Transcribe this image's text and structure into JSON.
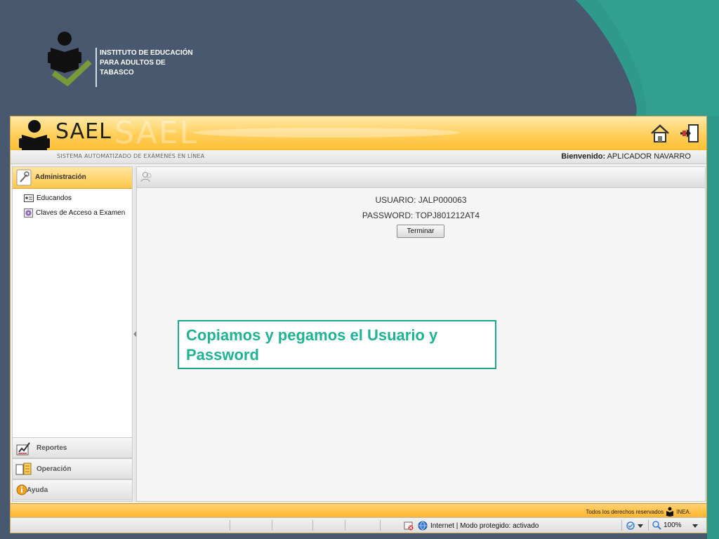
{
  "institution": {
    "lines": [
      "INSTITUTO DE EDUCACIÓN",
      "PARA ADULTOS DE",
      "TABASCO"
    ]
  },
  "app": {
    "title": "SAEL",
    "subtitle": "SISTEMA AUTOMATIZADO DE EXÁMENES EN LÍNEA",
    "welcome_label": "Bienvenido:",
    "welcome_user": "APLICADOR NAVARRO"
  },
  "sidebar": {
    "section_title": "Administración",
    "items": [
      {
        "label": "Educandos",
        "icon": "id-card-icon"
      },
      {
        "label": "Claves de Acceso a Examen",
        "icon": "key-disc-icon"
      }
    ],
    "bottom_nav": [
      {
        "label": "Reportes",
        "icon": "report-icon"
      },
      {
        "label": "Operación",
        "icon": "operation-icon"
      },
      {
        "label": "Ayuda",
        "icon": "help-icon"
      }
    ]
  },
  "main": {
    "usuario_line": "USUARIO: JALP000063",
    "password_line": "PASSWORD: TOPJ801212AT4",
    "terminar_label": "Terminar"
  },
  "callout": {
    "text": "Copiamos y pegamos el Usuario y Password"
  },
  "footer": {
    "copyright_left": "Todos los derechos reservados",
    "copyright_right": "INEA."
  },
  "statusbar": {
    "zone": "Internet | Modo protegido: activado",
    "zoom": "100%"
  },
  "colors": {
    "slide_bg": "#48586e",
    "slide_teal": "#2f9a8c",
    "app_orange": "#ffc84a",
    "callout_green": "#1fb393"
  }
}
